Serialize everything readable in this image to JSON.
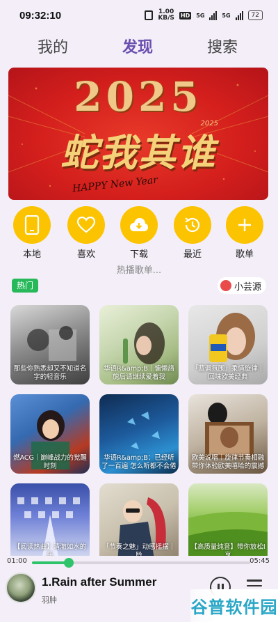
{
  "status_bar": {
    "time": "09:32:10",
    "speed_value": "1.00",
    "speed_unit": "KB/S",
    "hd": "HD",
    "sim1": "5G",
    "sim2": "5G",
    "battery": "72"
  },
  "tabs": [
    "我的",
    "发现",
    "搜索"
  ],
  "active_tab": "发现",
  "banner": {
    "year": "2025",
    "title": "蛇我其谁",
    "subtitle": "HAPPY New Year",
    "small_year": "2025"
  },
  "shortcuts": [
    {
      "label": "本地",
      "icon": "phone-icon"
    },
    {
      "label": "喜欢",
      "icon": "heart-icon"
    },
    {
      "label": "下载",
      "icon": "download-cloud-icon"
    },
    {
      "label": "最近",
      "icon": "history-icon"
    },
    {
      "label": "歌单",
      "icon": "plus-icon"
    }
  ],
  "section_hint": "热播歌单...",
  "hot_tag": "热门",
  "source_button": "小芸源",
  "playlists": [
    "那些你熟悉却又不知道名字的轻音乐",
    "华语R&amp;B｜慵懒旖旎后请继续爱着我",
    "「蓝调氛围」柔情旋律｜回味欧美经典",
    "燃ACG｜巅峰战力的觉醒时刻",
    "华语R&amp;B：已经听了一百遍 怎么听都不会倦",
    "欧美说唱｜旋律节奏相融带你体验欧美嘻哈的震撼",
    "【阅读热曲】清澈如水的乐",
    "「节奏之魅」动感摇摆｜聆",
    "【高质量纯音】带你放松I享"
  ],
  "player": {
    "current_time": "01:00",
    "total_time": "05:45",
    "progress": 0.17,
    "title": "1.Rain after Summer",
    "artist": "羽肿"
  },
  "watermark": "谷普软件园",
  "colors": {
    "accent": "#6a4fb0",
    "shortcut_yellow": "#fcc400",
    "hot_green": "#27b85a",
    "progress_green": "#2fc46a",
    "background": "#f3eef7"
  }
}
